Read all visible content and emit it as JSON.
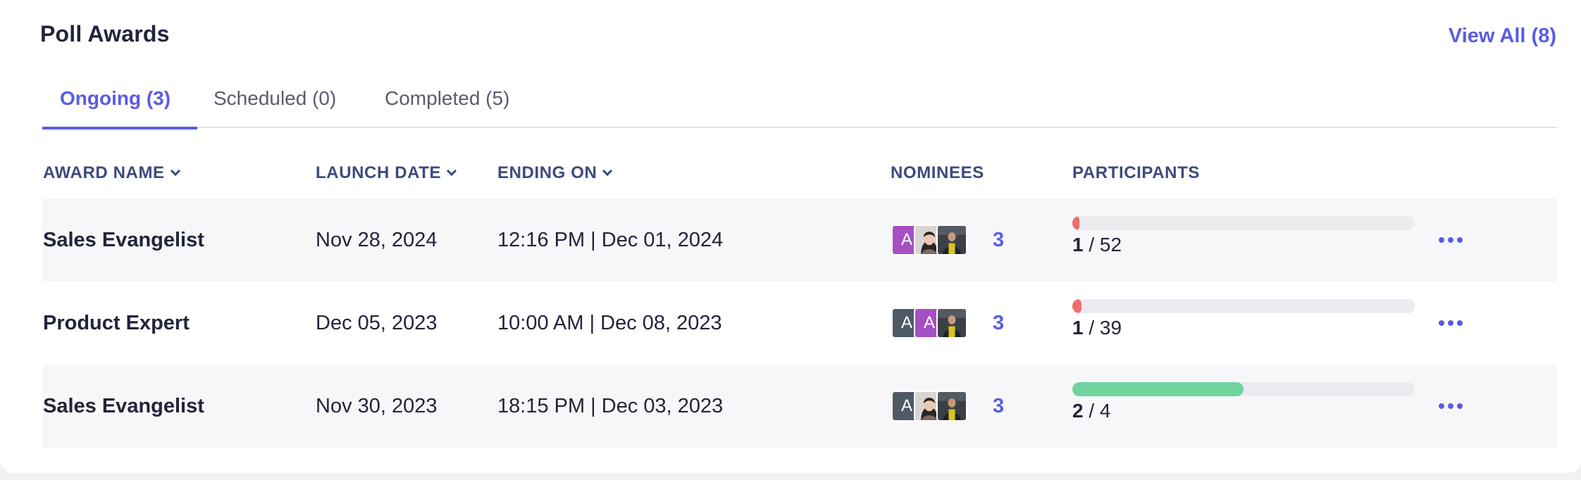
{
  "header": {
    "title": "Poll Awards",
    "view_all_label": "View All (8)"
  },
  "tabs": [
    {
      "label": "Ongoing (3)",
      "active": true
    },
    {
      "label": "Scheduled (0)",
      "active": false
    },
    {
      "label": "Completed (5)",
      "active": false
    }
  ],
  "table": {
    "columns": {
      "award_name": "AWARD NAME",
      "launch_date": "LAUNCH DATE",
      "ending_on": "ENDING ON",
      "nominees": "NOMINEES",
      "participants": "PARTICIPANTS"
    },
    "rows": [
      {
        "award_name": "Sales Evangelist",
        "launch_date": "Nov 28, 2024",
        "ending_on": "12:16 PM | Dec 01, 2024",
        "nominee_avatars": [
          {
            "type": "initial",
            "letter": "A",
            "color": "#a64fc2"
          },
          {
            "type": "photo",
            "icon": "woman-photo"
          },
          {
            "type": "photo",
            "icon": "man-photo"
          }
        ],
        "nominee_count": "3",
        "participants_current": "1",
        "participants_total": "52",
        "participation_fraction": 0.019,
        "progress_color": "#f06b6b"
      },
      {
        "award_name": "Product Expert",
        "launch_date": "Dec 05, 2023",
        "ending_on": "10:00 AM | Dec 08, 2023",
        "nominee_avatars": [
          {
            "type": "initial",
            "letter": "A",
            "color": "#4d5a66"
          },
          {
            "type": "initial",
            "letter": "A",
            "color": "#a64fc2"
          },
          {
            "type": "photo",
            "icon": "man-photo"
          }
        ],
        "nominee_count": "3",
        "participants_current": "1",
        "participants_total": "39",
        "participation_fraction": 0.026,
        "progress_color": "#f06b6b"
      },
      {
        "award_name": "Sales Evangelist",
        "launch_date": "Nov 30, 2023",
        "ending_on": "18:15 PM | Dec 03, 2023",
        "nominee_avatars": [
          {
            "type": "initial",
            "letter": "A",
            "color": "#4d5a66"
          },
          {
            "type": "photo",
            "icon": "woman-photo"
          },
          {
            "type": "photo",
            "icon": "man-photo"
          }
        ],
        "nominee_count": "3",
        "participants_current": "2",
        "participants_total": "4",
        "participation_fraction": 0.5,
        "progress_color": "#6fd49e"
      }
    ]
  },
  "colors": {
    "accent": "#5b5ce2",
    "heading": "#3e4a7c",
    "low_progress": "#f06b6b",
    "good_progress": "#6fd49e"
  }
}
